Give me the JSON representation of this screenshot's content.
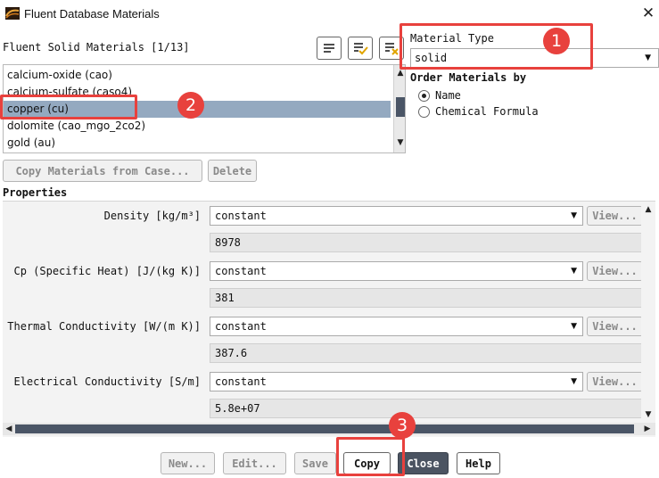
{
  "window": {
    "title": "Fluent Database Materials",
    "close_glyph": "✕"
  },
  "materials_list": {
    "label": "Fluent Solid Materials [1/13]",
    "items": [
      {
        "label": "calcium-oxide (cao)",
        "selected": false
      },
      {
        "label": "calcium-sulfate (caso4)",
        "selected": false
      },
      {
        "label": "copper (cu)",
        "selected": true
      },
      {
        "label": "dolomite (cao_mgo_2co2)",
        "selected": false
      },
      {
        "label": "gold (au)",
        "selected": false
      }
    ],
    "toolbar_icons": [
      "list-icon",
      "list-check-icon",
      "list-clear-icon"
    ]
  },
  "material_type": {
    "label": "Material Type",
    "value": "solid"
  },
  "order_by": {
    "label": "Order Materials by",
    "options": [
      {
        "label": "Name",
        "selected": true
      },
      {
        "label": "Chemical Formula",
        "selected": false
      }
    ]
  },
  "actions": {
    "copy_from_case": "Copy Materials from Case...",
    "delete": "Delete"
  },
  "properties": {
    "label": "Properties",
    "view_label": "View...",
    "items": [
      {
        "label": "Density [kg/m³]",
        "method": "constant",
        "value": "8978"
      },
      {
        "label": "Cp (Specific Heat) [J/(kg K)]",
        "method": "constant",
        "value": "381"
      },
      {
        "label": "Thermal Conductivity [W/(m K)]",
        "method": "constant",
        "value": "387.6"
      },
      {
        "label": "Electrical Conductivity [S/m]",
        "method": "constant",
        "value": "5.8e+07"
      }
    ]
  },
  "footer": {
    "new": "New...",
    "edit": "Edit...",
    "save": "Save",
    "copy": "Copy",
    "close": "Close",
    "help": "Help"
  },
  "annotations": [
    "1",
    "2",
    "3"
  ],
  "colors": {
    "accent_red": "#e8413d",
    "selection": "#94a9c0",
    "dark_button": "#4b5462"
  }
}
